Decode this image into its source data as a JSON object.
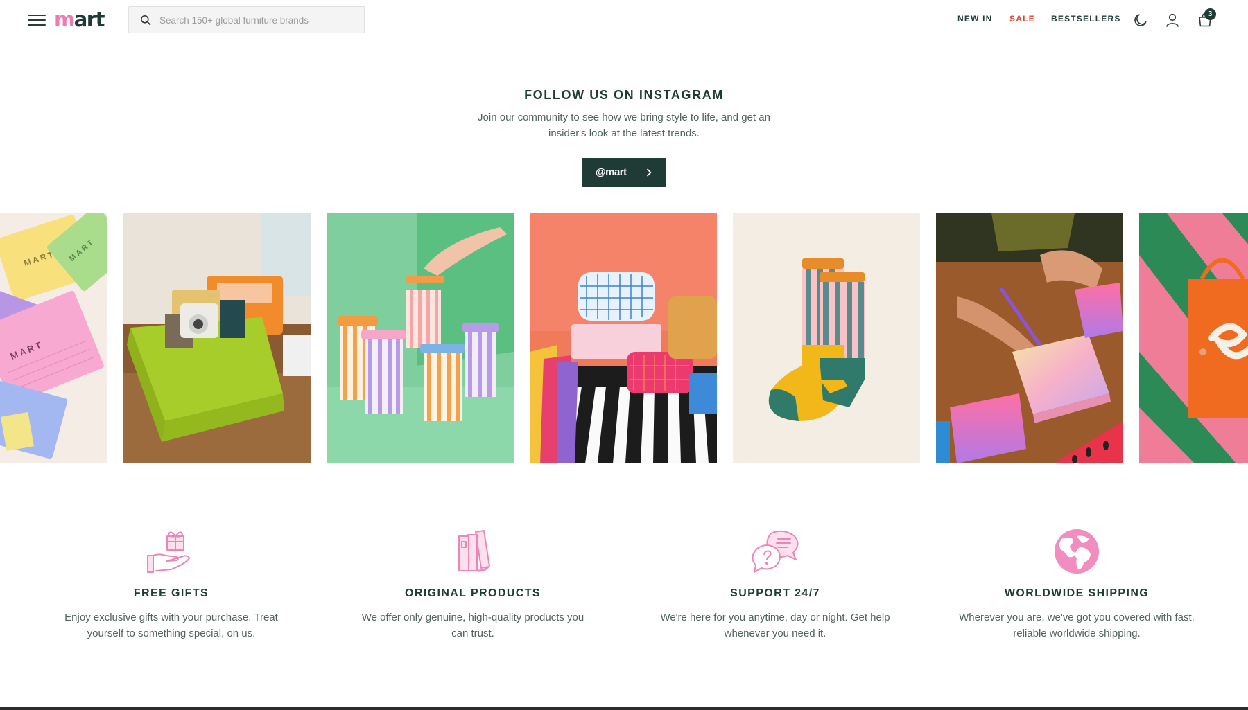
{
  "header": {
    "logo_prefix": "m",
    "logo_rest": "art",
    "search_placeholder": "Search 150+ global furniture brands",
    "nav": {
      "new_in": "NEW IN",
      "sale": "SALE",
      "bestsellers": "BESTSELLERS"
    },
    "cart_count": "3",
    "colors": {
      "brand_pink": "#f07ab2",
      "brand_green": "#1f3b36",
      "sale_red": "#e1452f"
    }
  },
  "instagram": {
    "title": "FOLLOW US ON INSTAGRAM",
    "subtitle": "Join our community to see how we bring style to life, and get an insider's look at the latest trends.",
    "button_label": "@mart",
    "tiles": [
      {
        "name": "sticky-notes-photo"
      },
      {
        "name": "green-crate-camera-photo"
      },
      {
        "name": "striped-travel-mugs-photo"
      },
      {
        "name": "pencil-case-stripes-photo"
      },
      {
        "name": "colorful-socks-photo"
      },
      {
        "name": "gradient-notepads-photo"
      },
      {
        "name": "orange-tote-bag-photo"
      }
    ]
  },
  "features": [
    {
      "icon": "gift-in-hand-icon",
      "title": "FREE GIFTS",
      "desc": "Enjoy exclusive gifts with your purchase. Treat yourself to something special, on us."
    },
    {
      "icon": "books-icon",
      "title": "ORIGINAL PRODUCTS",
      "desc": "We offer only genuine, high-quality products you can trust."
    },
    {
      "icon": "chat-support-icon",
      "title": "SUPPORT 24/7",
      "desc": "We're here for you anytime, day or night. Get help whenever you need it."
    },
    {
      "icon": "globe-icon",
      "title": "WORLDWIDE SHIPPING",
      "desc": "Wherever you are, we've got you covered with fast, reliable worldwide shipping."
    }
  ]
}
